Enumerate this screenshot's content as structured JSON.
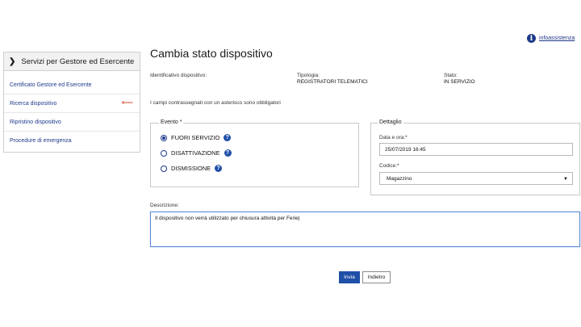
{
  "header": {
    "info_link": "infoassistenza"
  },
  "sidebar": {
    "title": "Servizi per Gestore ed Esercente",
    "items": [
      {
        "label": "Certificato Gestore ed Esercente"
      },
      {
        "label": "Ricerca dispositivo"
      },
      {
        "label": "Ripristino dispositivo"
      },
      {
        "label": "Procedure di emergenza"
      }
    ]
  },
  "main": {
    "title": "Cambia stato dispositivo",
    "fields": {
      "identificativo_label": "Identificativo dispositivo:",
      "tipologia_label": "Tipologia:",
      "tipologia_value": "REGISTRATORI TELEMATICI",
      "stato_label": "Stato:",
      "stato_value": "IN SERVIZIO"
    },
    "required_note": "I campi contrassegnati con un asterisco sono obbligatori",
    "evento": {
      "legend": "Evento *",
      "options": [
        {
          "label": "FUORI SERVIZIO",
          "checked": true
        },
        {
          "label": "DISATTIVAZIONE",
          "checked": false
        },
        {
          "label": "DISMISSIONE",
          "checked": false
        }
      ]
    },
    "dettaglio": {
      "legend": "Dettaglio",
      "data_ora_label": "Data e ora:*",
      "data_ora_value": "25/07/2019 16:45",
      "codice_label": "Codice:*",
      "codice_value": "Magazzino"
    },
    "descrizione": {
      "label": "Descrizione:",
      "value": "Il dispositivo non verrà utilizzato per chiusura attività per Ferie|"
    },
    "buttons": {
      "submit": "Invia",
      "back": "Indietro"
    }
  },
  "colors": {
    "primary": "#1f4fa6",
    "link": "#1f3a8a",
    "active_arrow": "#d9472b"
  }
}
